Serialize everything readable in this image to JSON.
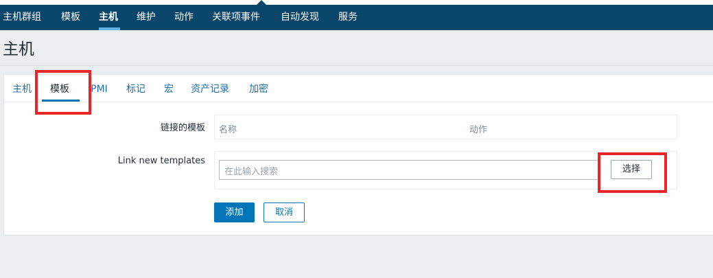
{
  "nav": {
    "items": [
      {
        "label": "主机群组"
      },
      {
        "label": "模板"
      },
      {
        "label": "主机"
      },
      {
        "label": "维护"
      },
      {
        "label": "动作"
      },
      {
        "label": "关联项事件"
      },
      {
        "label": "自动发现"
      },
      {
        "label": "服务"
      }
    ],
    "active_index": 2
  },
  "page": {
    "title": "主机"
  },
  "tabs": [
    {
      "label": "主机"
    },
    {
      "label": "模板"
    },
    {
      "label": "IPMI"
    },
    {
      "label": "标记"
    },
    {
      "label": "宏"
    },
    {
      "label": "资产记录"
    },
    {
      "label": "加密"
    }
  ],
  "active_tab": "模板",
  "form": {
    "linked_templates": {
      "label": "链接的模板",
      "columns": [
        "名称",
        "动作"
      ]
    },
    "link_new": {
      "label": "Link new templates",
      "placeholder": "在此输入搜索",
      "select_label": "选择"
    },
    "add_label": "添加",
    "cancel_label": "取消"
  },
  "colors": {
    "topbar": "#0a466a",
    "accent": "#0275b8",
    "link": "#1f6fa3",
    "highlight": "#e8262a"
  }
}
